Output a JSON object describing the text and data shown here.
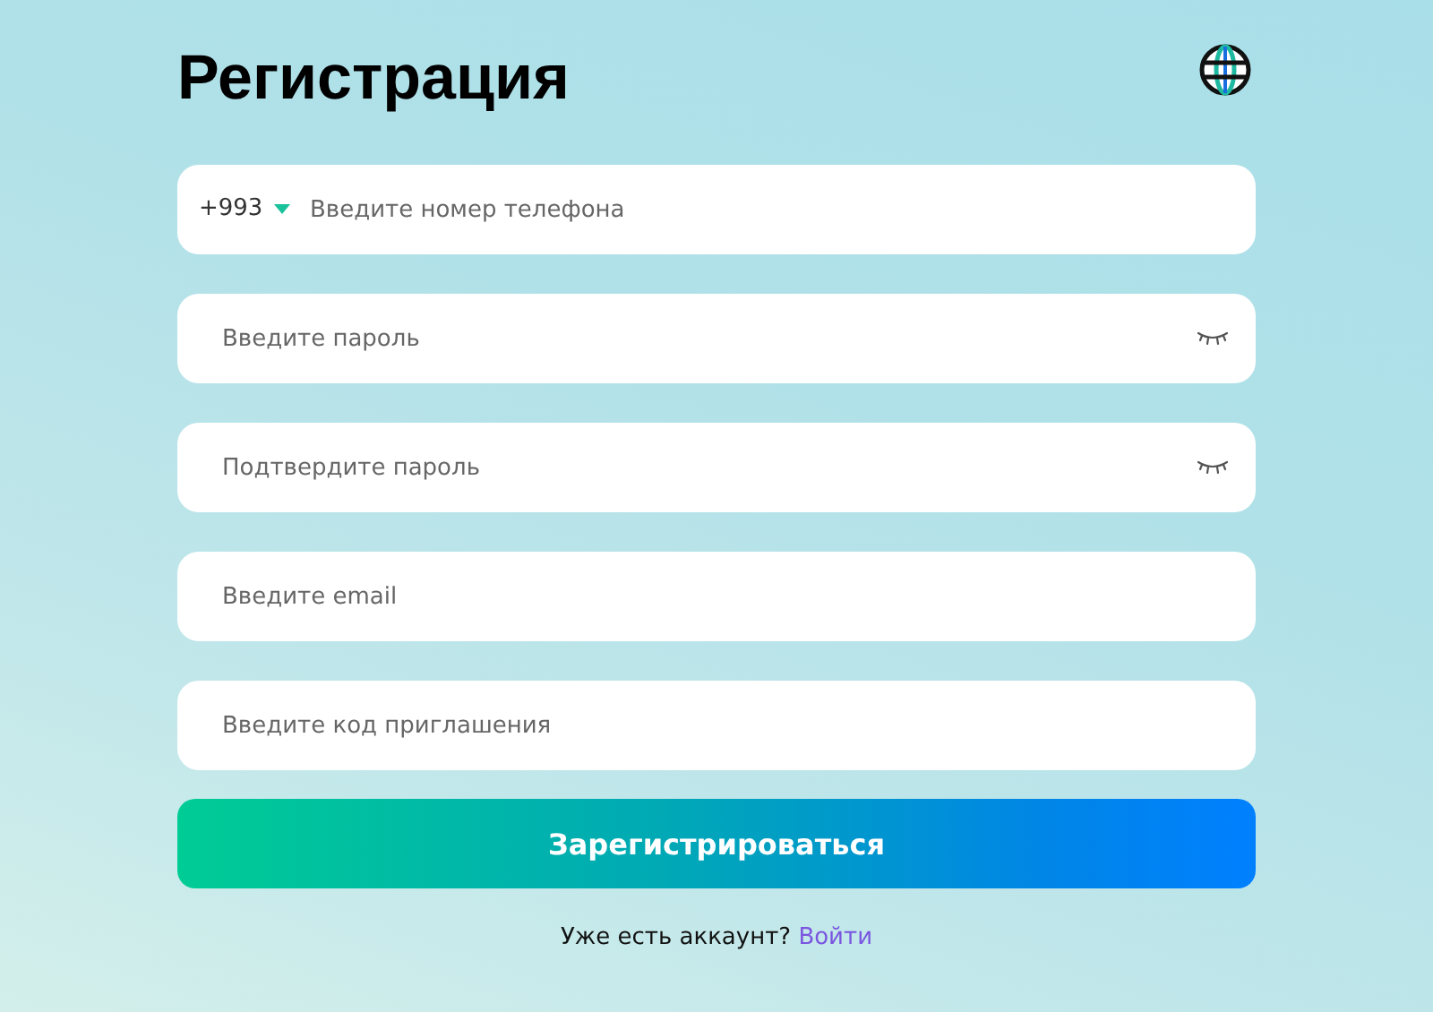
{
  "title": "Регистрация",
  "fields": [
    {
      "kind": "phone",
      "code": "+993",
      "placeholder": "Введите номер телефона"
    },
    {
      "kind": "password",
      "placeholder": "Введите пароль"
    },
    {
      "kind": "password",
      "placeholder": "Подтвердите пароль"
    },
    {
      "kind": "text",
      "placeholder": "Введите email"
    },
    {
      "kind": "text",
      "placeholder": "Введите код приглашения"
    }
  ],
  "submit": "Зарегистрироваться",
  "footer": {
    "text": "Уже есть аккаунт?",
    "link": "Войти"
  }
}
